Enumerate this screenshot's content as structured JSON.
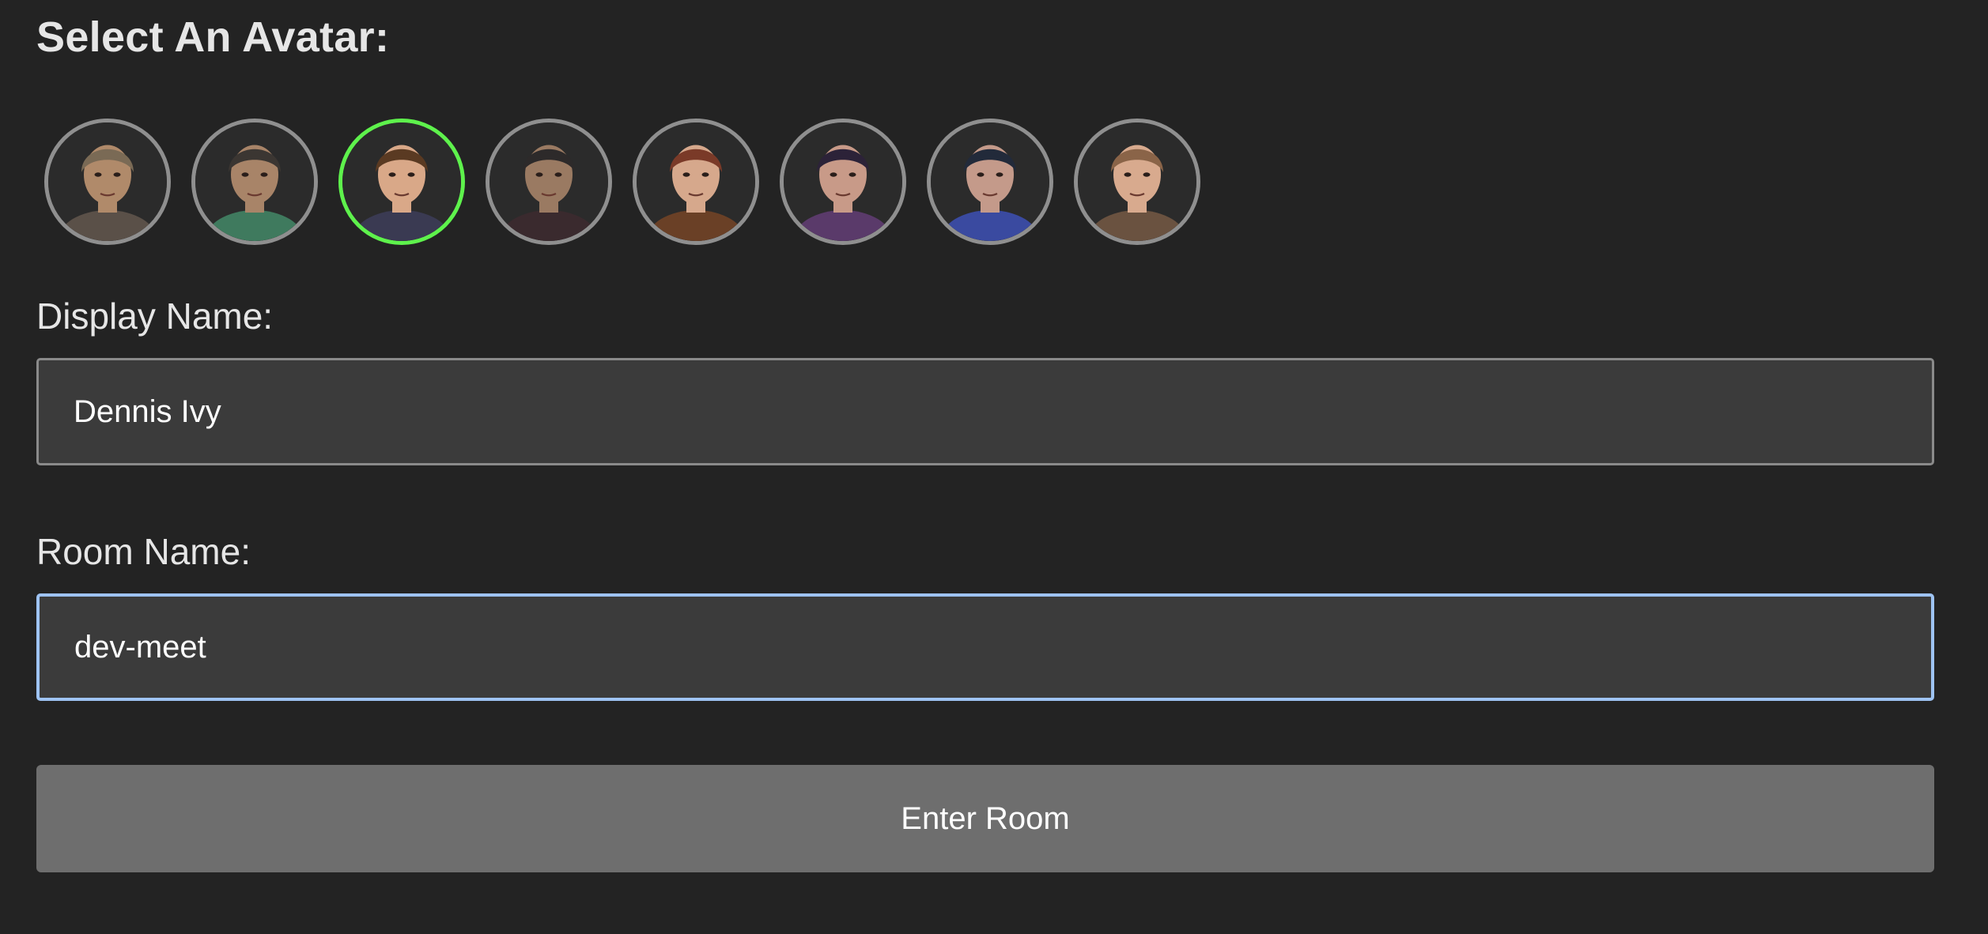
{
  "header": {
    "title": "Select An Avatar:"
  },
  "avatars": {
    "items": [
      {
        "name": "bald-man-portrait",
        "selected": false,
        "skin": "#b08a6a",
        "hair": "#7a6a55",
        "cloth": "#5a5048"
      },
      {
        "name": "bearded-man-portrait",
        "selected": false,
        "skin": "#a88468",
        "hair": "#3b3632",
        "cloth": "#3f7a5e"
      },
      {
        "name": "young-man-portrait",
        "selected": true,
        "skin": "#d9a888",
        "hair": "#5a3a22",
        "cloth": "#3a3a52"
      },
      {
        "name": "hooded-man-portrait",
        "selected": false,
        "skin": "#9a7a62",
        "hair": "#2d2a2a",
        "cloth": "#3a2a2e"
      },
      {
        "name": "red-haired-woman-portrait",
        "selected": false,
        "skin": "#d6a88c",
        "hair": "#7a3a28",
        "cloth": "#6a4026"
      },
      {
        "name": "dark-haired-woman-portrait",
        "selected": false,
        "skin": "#c89a88",
        "hair": "#2c2238",
        "cloth": "#5a3a6a"
      },
      {
        "name": "blue-haired-woman-portrait",
        "selected": false,
        "skin": "#c49a8a",
        "hair": "#222a3a",
        "cloth": "#3a4aa0"
      },
      {
        "name": "brown-haired-woman-portrait",
        "selected": false,
        "skin": "#d8aa8e",
        "hair": "#8a6448",
        "cloth": "#6a5240"
      }
    ],
    "selected_color": "#5ef24c",
    "default_border_color": "#8f8f8f"
  },
  "form": {
    "display_name": {
      "label": "Display Name:",
      "value": "Dennis Ivy"
    },
    "room_name": {
      "label": "Room Name:",
      "value": "dev-meet"
    },
    "submit_label": "Enter Room"
  }
}
